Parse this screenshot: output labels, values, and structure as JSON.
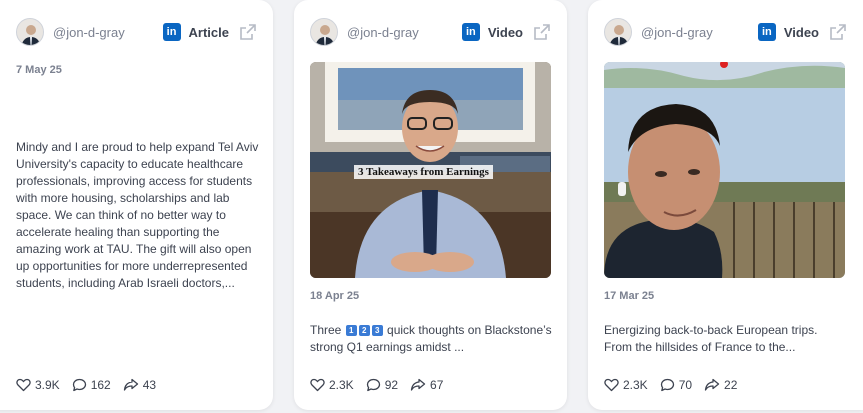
{
  "cards": [
    {
      "handle": "@jon-d-gray",
      "platform_badge": "in",
      "post_type": "Article",
      "date": "7 May 25",
      "text": "Mindy and I are proud to help expand Tel Aviv University's capacity to educate healthcare professionals, improving access for students with more housing, scholarships and lab space. We can think of no better way to accelerate healing than supporting the amazing work at TAU. The gift will also open up opportunities for more underrepresented students, including Arab Israeli doctors,...",
      "likes": "3.9K",
      "comments": "162",
      "shares": "43"
    },
    {
      "handle": "@jon-d-gray",
      "platform_badge": "in",
      "post_type": "Video",
      "date": "18 Apr 25",
      "media_caption": "3 Takeaways from Earnings",
      "text_before": "Three",
      "keycaps": [
        "1",
        "2",
        "3"
      ],
      "text_after": "quick thoughts on Blackstone’s strong Q1 earnings amidst ...",
      "likes": "2.3K",
      "comments": "92",
      "shares": "67"
    },
    {
      "handle": "@jon-d-gray",
      "platform_badge": "in",
      "post_type": "Video",
      "date": "17 Mar 25",
      "text": "Energizing back-to-back European trips. From the hillsides of France to the...",
      "likes": "2.3K",
      "comments": "70",
      "shares": "22"
    }
  ],
  "colors": {
    "linkedin": "#0a66c2",
    "muted_text": "#7b8190",
    "body_text": "#3d4350",
    "card_bg": "#ffffff",
    "page_bg": "#f1f2f5"
  },
  "icons": [
    "heart-icon",
    "comment-icon",
    "share-icon",
    "external-link-icon",
    "linkedin-icon"
  ]
}
